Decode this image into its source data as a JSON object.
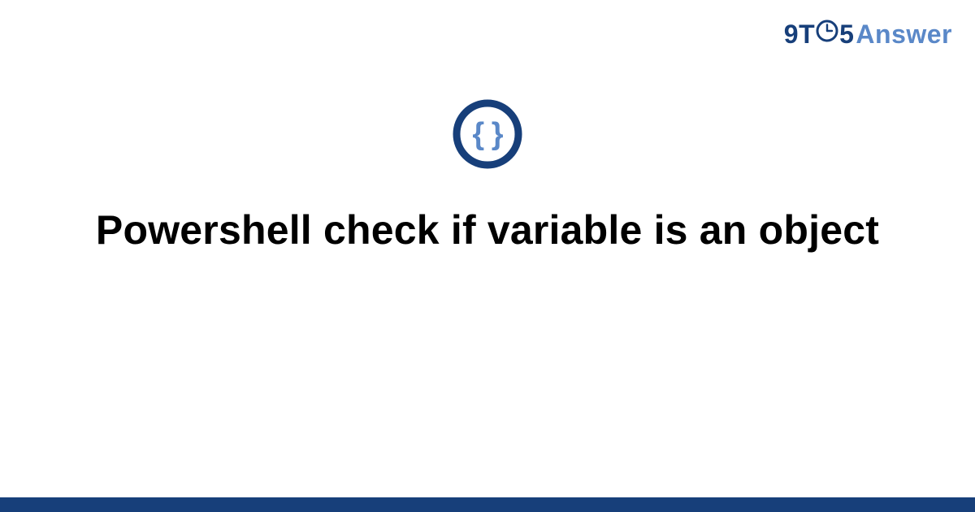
{
  "brand": {
    "nine": "9",
    "t": "T",
    "five": "5",
    "answer": "Answer"
  },
  "colors": {
    "brand_dark": "#173f7a",
    "brand_light": "#5a88c8",
    "braces": "#5a88c8",
    "circle": "#173f7a",
    "title": "#000000"
  },
  "title": "Powershell check if variable is an object"
}
